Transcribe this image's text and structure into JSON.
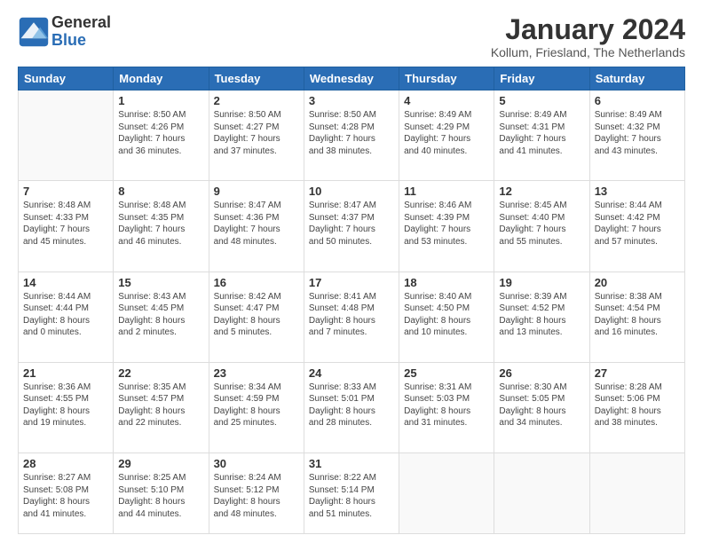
{
  "logo": {
    "general": "General",
    "blue": "Blue"
  },
  "title": "January 2024",
  "subtitle": "Kollum, Friesland, The Netherlands",
  "weekdays": [
    "Sunday",
    "Monday",
    "Tuesday",
    "Wednesday",
    "Thursday",
    "Friday",
    "Saturday"
  ],
  "weeks": [
    [
      {
        "day": "",
        "info": ""
      },
      {
        "day": "1",
        "info": "Sunrise: 8:50 AM\nSunset: 4:26 PM\nDaylight: 7 hours\nand 36 minutes."
      },
      {
        "day": "2",
        "info": "Sunrise: 8:50 AM\nSunset: 4:27 PM\nDaylight: 7 hours\nand 37 minutes."
      },
      {
        "day": "3",
        "info": "Sunrise: 8:50 AM\nSunset: 4:28 PM\nDaylight: 7 hours\nand 38 minutes."
      },
      {
        "day": "4",
        "info": "Sunrise: 8:49 AM\nSunset: 4:29 PM\nDaylight: 7 hours\nand 40 minutes."
      },
      {
        "day": "5",
        "info": "Sunrise: 8:49 AM\nSunset: 4:31 PM\nDaylight: 7 hours\nand 41 minutes."
      },
      {
        "day": "6",
        "info": "Sunrise: 8:49 AM\nSunset: 4:32 PM\nDaylight: 7 hours\nand 43 minutes."
      }
    ],
    [
      {
        "day": "7",
        "info": "Sunrise: 8:48 AM\nSunset: 4:33 PM\nDaylight: 7 hours\nand 45 minutes."
      },
      {
        "day": "8",
        "info": "Sunrise: 8:48 AM\nSunset: 4:35 PM\nDaylight: 7 hours\nand 46 minutes."
      },
      {
        "day": "9",
        "info": "Sunrise: 8:47 AM\nSunset: 4:36 PM\nDaylight: 7 hours\nand 48 minutes."
      },
      {
        "day": "10",
        "info": "Sunrise: 8:47 AM\nSunset: 4:37 PM\nDaylight: 7 hours\nand 50 minutes."
      },
      {
        "day": "11",
        "info": "Sunrise: 8:46 AM\nSunset: 4:39 PM\nDaylight: 7 hours\nand 53 minutes."
      },
      {
        "day": "12",
        "info": "Sunrise: 8:45 AM\nSunset: 4:40 PM\nDaylight: 7 hours\nand 55 minutes."
      },
      {
        "day": "13",
        "info": "Sunrise: 8:44 AM\nSunset: 4:42 PM\nDaylight: 7 hours\nand 57 minutes."
      }
    ],
    [
      {
        "day": "14",
        "info": "Sunrise: 8:44 AM\nSunset: 4:44 PM\nDaylight: 8 hours\nand 0 minutes."
      },
      {
        "day": "15",
        "info": "Sunrise: 8:43 AM\nSunset: 4:45 PM\nDaylight: 8 hours\nand 2 minutes."
      },
      {
        "day": "16",
        "info": "Sunrise: 8:42 AM\nSunset: 4:47 PM\nDaylight: 8 hours\nand 5 minutes."
      },
      {
        "day": "17",
        "info": "Sunrise: 8:41 AM\nSunset: 4:48 PM\nDaylight: 8 hours\nand 7 minutes."
      },
      {
        "day": "18",
        "info": "Sunrise: 8:40 AM\nSunset: 4:50 PM\nDaylight: 8 hours\nand 10 minutes."
      },
      {
        "day": "19",
        "info": "Sunrise: 8:39 AM\nSunset: 4:52 PM\nDaylight: 8 hours\nand 13 minutes."
      },
      {
        "day": "20",
        "info": "Sunrise: 8:38 AM\nSunset: 4:54 PM\nDaylight: 8 hours\nand 16 minutes."
      }
    ],
    [
      {
        "day": "21",
        "info": "Sunrise: 8:36 AM\nSunset: 4:55 PM\nDaylight: 8 hours\nand 19 minutes."
      },
      {
        "day": "22",
        "info": "Sunrise: 8:35 AM\nSunset: 4:57 PM\nDaylight: 8 hours\nand 22 minutes."
      },
      {
        "day": "23",
        "info": "Sunrise: 8:34 AM\nSunset: 4:59 PM\nDaylight: 8 hours\nand 25 minutes."
      },
      {
        "day": "24",
        "info": "Sunrise: 8:33 AM\nSunset: 5:01 PM\nDaylight: 8 hours\nand 28 minutes."
      },
      {
        "day": "25",
        "info": "Sunrise: 8:31 AM\nSunset: 5:03 PM\nDaylight: 8 hours\nand 31 minutes."
      },
      {
        "day": "26",
        "info": "Sunrise: 8:30 AM\nSunset: 5:05 PM\nDaylight: 8 hours\nand 34 minutes."
      },
      {
        "day": "27",
        "info": "Sunrise: 8:28 AM\nSunset: 5:06 PM\nDaylight: 8 hours\nand 38 minutes."
      }
    ],
    [
      {
        "day": "28",
        "info": "Sunrise: 8:27 AM\nSunset: 5:08 PM\nDaylight: 8 hours\nand 41 minutes."
      },
      {
        "day": "29",
        "info": "Sunrise: 8:25 AM\nSunset: 5:10 PM\nDaylight: 8 hours\nand 44 minutes."
      },
      {
        "day": "30",
        "info": "Sunrise: 8:24 AM\nSunset: 5:12 PM\nDaylight: 8 hours\nand 48 minutes."
      },
      {
        "day": "31",
        "info": "Sunrise: 8:22 AM\nSunset: 5:14 PM\nDaylight: 8 hours\nand 51 minutes."
      },
      {
        "day": "",
        "info": ""
      },
      {
        "day": "",
        "info": ""
      },
      {
        "day": "",
        "info": ""
      }
    ]
  ]
}
